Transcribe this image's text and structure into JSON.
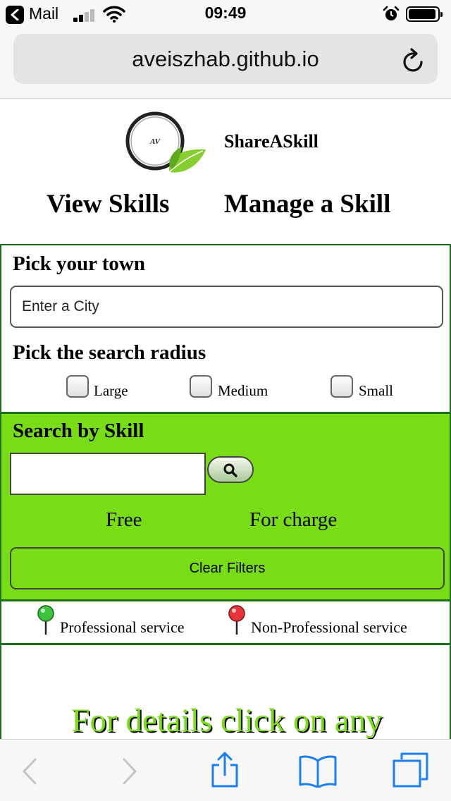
{
  "status_bar": {
    "back_app": "Mail",
    "time": "09:49",
    "signal_bars": 2,
    "icons": [
      "back-arrow-icon",
      "signal-icon",
      "wifi-icon",
      "alarm-icon",
      "battery-icon"
    ]
  },
  "browser": {
    "url": "aveiszhab.github.io",
    "reload_icon": "reload-icon"
  },
  "header": {
    "logo_text": "AV",
    "brand": "ShareASkill",
    "nav": [
      "View Skills",
      "Manage a Skill"
    ]
  },
  "town_panel": {
    "title": "Pick your town",
    "city_placeholder": "Enter a City",
    "radius_title": "Pick the search radius",
    "radius_options": [
      "Large",
      "Medium",
      "Small"
    ]
  },
  "skill_panel": {
    "title": "Search by Skill",
    "search_value": "",
    "search_icon": "magnifier-icon",
    "pricing": [
      "Free",
      "For charge"
    ],
    "clear_label": "Clear Filters"
  },
  "legend": {
    "professional": "Professional service",
    "non_professional": "Non-Professional service"
  },
  "details": {
    "text": "For details click on any"
  },
  "colors": {
    "accent_green": "#78dd15",
    "border_green": "#1d6f1d",
    "professional_pin": "#3cc43c",
    "non_professional_pin": "#e8333a",
    "ios_blue": "#1a7ff0"
  },
  "toolbar": {
    "icons": [
      "back-icon",
      "forward-icon",
      "share-icon",
      "bookmarks-icon",
      "tabs-icon"
    ]
  }
}
